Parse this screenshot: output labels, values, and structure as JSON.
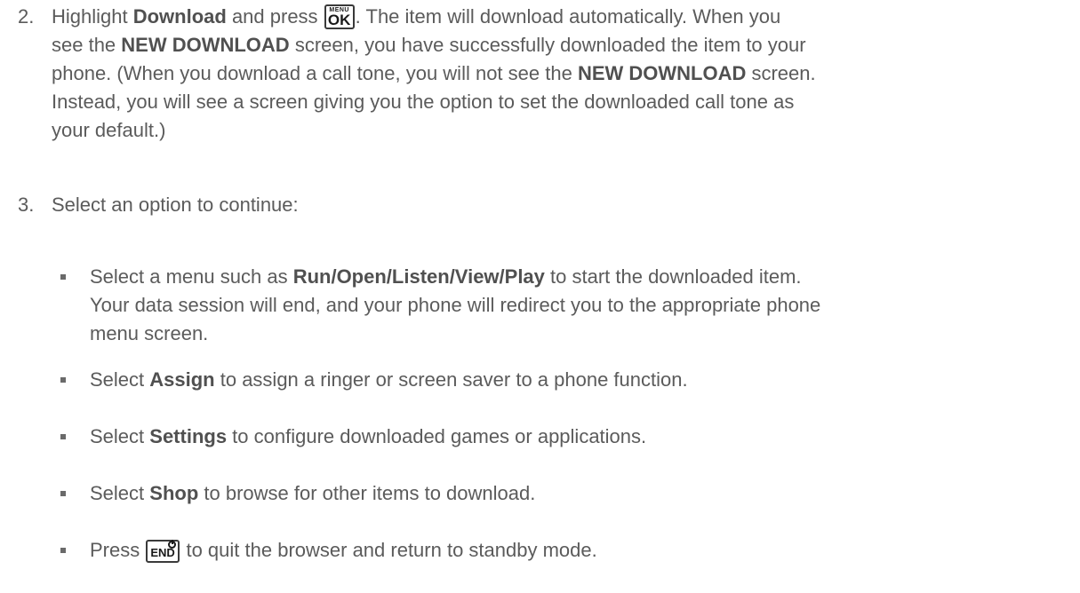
{
  "steps": [
    {
      "number": "2.",
      "lines": [
        [
          {
            "t": "Highlight "
          },
          {
            "t": "Download",
            "b": true
          },
          {
            "t": " and press "
          },
          {
            "key": "menu-ok"
          },
          {
            "t": ". The item will download automatically. When you"
          }
        ],
        [
          {
            "t": "see the "
          },
          {
            "t": "NEW DOWNLOAD",
            "b": true
          },
          {
            "t": " screen, you have successfully downloaded the item to your"
          }
        ],
        [
          {
            "t": "phone. (When you download a call tone, you will not see the "
          },
          {
            "t": "NEW DOWNLOAD",
            "b": true
          },
          {
            "t": " screen."
          }
        ],
        [
          {
            "t": "Instead, you will see a screen giving you the option to set the downloaded call tone as"
          }
        ],
        [
          {
            "t": "your default.)"
          }
        ]
      ]
    },
    {
      "number": "3.",
      "lines": [
        [
          {
            "t": "Select an option to continue:"
          }
        ]
      ]
    }
  ],
  "bullets": [
    {
      "lines": [
        [
          {
            "t": "Select a menu such as "
          },
          {
            "t": "Run/Open/Listen/View/Play",
            "b": true
          },
          {
            "t": " to start the downloaded item."
          }
        ],
        [
          {
            "t": "Your data session will end, and your phone will redirect you to the appropriate phone"
          }
        ],
        [
          {
            "t": "menu screen."
          }
        ]
      ]
    },
    {
      "lines": [
        [
          {
            "t": "Select "
          },
          {
            "t": "Assign",
            "b": true
          },
          {
            "t": " to assign a ringer or screen saver to a phone function."
          }
        ]
      ]
    },
    {
      "lines": [
        [
          {
            "t": "Select "
          },
          {
            "t": "Settings",
            "b": true
          },
          {
            "t": " to configure downloaded games or applications."
          }
        ]
      ]
    },
    {
      "lines": [
        [
          {
            "t": "Select "
          },
          {
            "t": "Shop",
            "b": true
          },
          {
            "t": " to browse for other items to download."
          }
        ]
      ]
    },
    {
      "lines": [
        [
          {
            "t": "Press "
          },
          {
            "key": "end"
          },
          {
            "t": " to quit the browser and return to standby mode."
          }
        ]
      ]
    }
  ],
  "keys": {
    "menu-ok": {
      "top": "MENU",
      "main": "OK"
    },
    "end": {
      "main": "END"
    }
  },
  "colors": {
    "text": "#5b5b5b",
    "key_border": "#3a3a3a"
  }
}
